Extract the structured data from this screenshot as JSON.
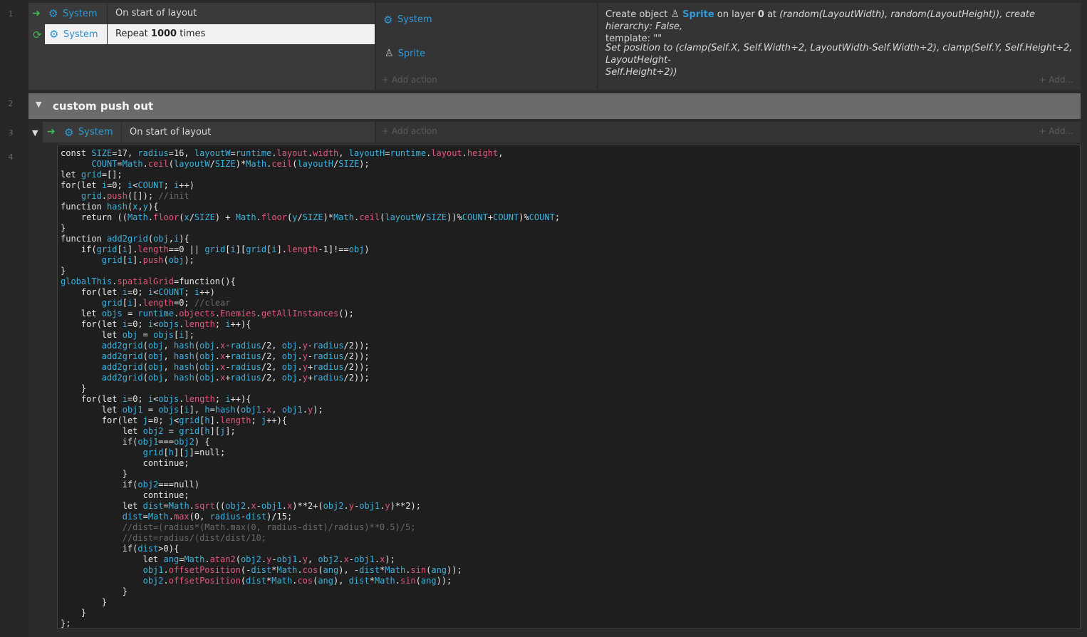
{
  "line_numbers": [
    "1",
    "2",
    "3",
    "4"
  ],
  "event1": {
    "conditions": [
      {
        "icon": "arrow-right-icon",
        "object": "System",
        "text": "On start of layout",
        "selected": false
      },
      {
        "icon": "repeat-icon",
        "object": "System",
        "text_pre": "Repeat ",
        "text_bold": "1000",
        "text_post": " times",
        "selected": true
      }
    ],
    "action_objects": [
      "System",
      "Sprite"
    ],
    "actions": [
      {
        "pre": "Create object ",
        "object": "Sprite",
        "mid": " on layer ",
        "layer": "0",
        "post": " at ",
        "params": "(random(LayoutWidth), random(LayoutHeight)), create hierarchy: False,",
        "line2": "template: \"\""
      },
      {
        "line1": "Set position to (clamp(Self.X, Self.Width÷2, LayoutWidth-Self.Width÷2), clamp(Self.Y, Self.Height÷2, LayoutHeight-",
        "line2": "Self.Height÷2))"
      }
    ],
    "add_action": "Add action",
    "add_more": "Add..."
  },
  "group": {
    "title": "custom push out"
  },
  "event3": {
    "object": "System",
    "condition": "On start of layout",
    "add_action": "Add action",
    "add_more": "Add..."
  }
}
